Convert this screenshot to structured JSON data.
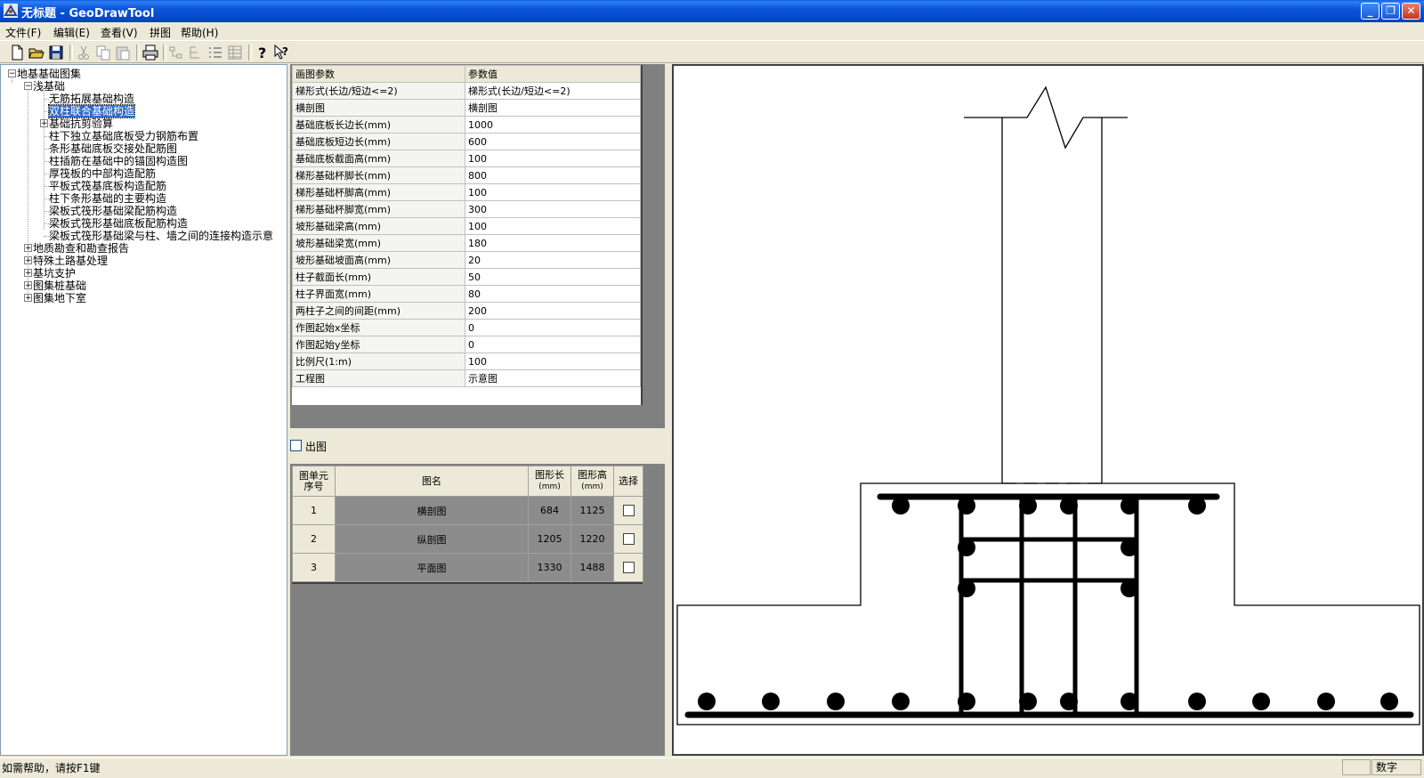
{
  "window": {
    "title": "无标题 - GeoDrawTool"
  },
  "menu": [
    "文件(F)",
    "编辑(E)",
    "查看(V)",
    "拼图",
    "帮助(H)"
  ],
  "toolbar": [
    {
      "icon": "new-file-icon",
      "enabled": true
    },
    {
      "icon": "open-folder-icon",
      "enabled": true
    },
    {
      "icon": "save-icon",
      "enabled": true
    },
    {
      "icon": "cut-icon",
      "enabled": false
    },
    {
      "icon": "copy-icon",
      "enabled": false
    },
    {
      "icon": "paste-icon",
      "enabled": false
    },
    {
      "icon": "print-icon",
      "enabled": true
    },
    {
      "icon": "view-icon",
      "enabled": false
    },
    {
      "icon": "tree-icon",
      "enabled": false
    },
    {
      "icon": "list-icon",
      "enabled": false
    },
    {
      "icon": "details-icon",
      "enabled": false
    },
    {
      "icon": "help-icon",
      "enabled": true
    },
    {
      "icon": "context-help-icon",
      "enabled": true
    }
  ],
  "tree": {
    "items": [
      {
        "label": "地基基础图集",
        "level": 0,
        "expander": "-"
      },
      {
        "label": "浅基础",
        "level": 1,
        "expander": "-"
      },
      {
        "label": "无筋拓展基础构造",
        "level": 2,
        "expander": ""
      },
      {
        "label": "双柱联合基础构造",
        "level": 2,
        "expander": "",
        "selected": true
      },
      {
        "label": "基础抗剪验算",
        "level": 2,
        "expander": "+"
      },
      {
        "label": "柱下独立基础底板受力钢筋布置",
        "level": 2,
        "expander": ""
      },
      {
        "label": "条形基础底板交接处配筋图",
        "level": 2,
        "expander": ""
      },
      {
        "label": "柱插筋在基础中的锚固构造图",
        "level": 2,
        "expander": ""
      },
      {
        "label": "厚筏板的中部构造配筋",
        "level": 2,
        "expander": ""
      },
      {
        "label": "平板式筏基底板构造配筋",
        "level": 2,
        "expander": ""
      },
      {
        "label": "柱下条形基础的主要构造",
        "level": 2,
        "expander": ""
      },
      {
        "label": "梁板式筏形基础梁配筋构造",
        "level": 2,
        "expander": ""
      },
      {
        "label": "梁板式筏形基础底板配筋构造",
        "level": 2,
        "expander": ""
      },
      {
        "label": "梁板式筏形基础梁与柱、墙之间的连接构造示意",
        "level": 2,
        "expander": ""
      },
      {
        "label": "地质勘查和勘查报告",
        "level": 1,
        "expander": "+"
      },
      {
        "label": "特殊土路基处理",
        "level": 1,
        "expander": "+"
      },
      {
        "label": "基坑支护",
        "level": 1,
        "expander": "+"
      },
      {
        "label": "图集桩基础",
        "level": 1,
        "expander": "+"
      },
      {
        "label": "图集地下室",
        "level": 1,
        "expander": "+"
      }
    ]
  },
  "params": {
    "header": [
      "画图参数",
      "参数值"
    ],
    "rows": [
      [
        "梯形式(长边/短边<=2)",
        "梯形式(长边/短边<=2)"
      ],
      [
        "横剖图",
        "横剖图"
      ],
      [
        "基础底板长边长(mm)",
        "1000"
      ],
      [
        "基础底板短边长(mm)",
        "600"
      ],
      [
        "基础底板截面高(mm)",
        "100"
      ],
      [
        "梯形基础杯脚长(mm)",
        "800"
      ],
      [
        "梯形基础杯脚高(mm)",
        "100"
      ],
      [
        "梯形基础杯脚宽(mm)",
        "300"
      ],
      [
        "坡形基础梁高(mm)",
        "100"
      ],
      [
        "坡形基础梁宽(mm)",
        "180"
      ],
      [
        "坡形基础坡面高(mm)",
        "20"
      ],
      [
        "柱子截面长(mm)",
        "50"
      ],
      [
        "柱子界面宽(mm)",
        "80"
      ],
      [
        "两柱子之间的间距(mm)",
        "200"
      ],
      [
        "作图起始x坐标",
        "0"
      ],
      [
        "作图起始y坐标",
        "0"
      ],
      [
        "比例尺(1:m)",
        "100"
      ],
      [
        "工程图",
        "示意图"
      ]
    ]
  },
  "output_checkbox": {
    "label": "出图",
    "checked": false
  },
  "figure_list": {
    "header": {
      "index_line1": "图单元",
      "index_line2": "序号",
      "name": "图名",
      "length_line1": "图形长",
      "length_line2": "(mm)",
      "height_line1": "图形高",
      "height_line2": "(mm)",
      "select": "选择"
    },
    "rows": [
      {
        "index": "1",
        "name": "横剖图",
        "length": "684",
        "height": "1125",
        "checked": false
      },
      {
        "index": "2",
        "name": "纵剖图",
        "length": "1205",
        "height": "1220",
        "checked": false
      },
      {
        "index": "3",
        "name": "平面图",
        "length": "1330",
        "height": "1488",
        "checked": false
      }
    ]
  },
  "status": {
    "help": "如需帮助，请按F1键",
    "mode": "数字"
  }
}
